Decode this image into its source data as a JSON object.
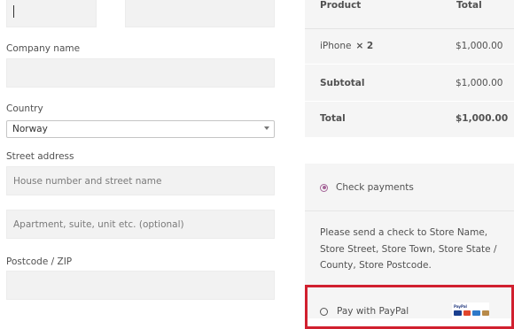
{
  "form": {
    "company_label": "Company name",
    "country_label": "Country",
    "country_value": "Norway",
    "street_label": "Street address",
    "street_placeholder": "House number and street name",
    "apartment_placeholder": "Apartment, suite, unit etc. (optional)",
    "postcode_label": "Postcode / ZIP"
  },
  "order": {
    "header_product": "Product",
    "header_total": "Total",
    "item_name": "iPhone",
    "item_qty": "× 2",
    "item_total": "$1,000.00",
    "subtotal_label": "Subtotal",
    "subtotal_value": "$1,000.00",
    "total_label": "Total",
    "total_value": "$1,000.00"
  },
  "payment": {
    "check_label": "Check payments",
    "check_description": "Please send a check to Store Name, Store Street, Store Town, Store State / County, Store Postcode.",
    "paypal_label": "Pay with PayPal",
    "paypal_logo_text": "PayPal",
    "highlight_color": "#d1202f",
    "accent_color": "#a46497"
  }
}
